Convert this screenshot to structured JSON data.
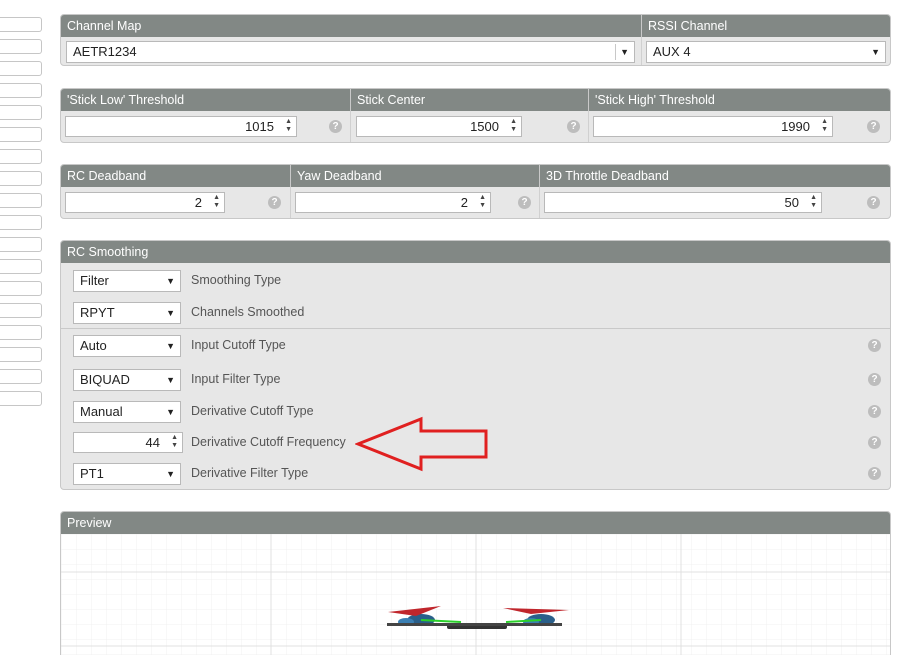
{
  "channel_map": {
    "header": "Channel Map",
    "value": "AETR1234"
  },
  "rssi_channel": {
    "header": "RSSI Channel",
    "value": "AUX 4"
  },
  "thresholds": [
    {
      "header": "'Stick Low' Threshold",
      "value": "1015"
    },
    {
      "header": "Stick Center",
      "value": "1500"
    },
    {
      "header": "'Stick High' Threshold",
      "value": "1990"
    }
  ],
  "deadbands": [
    {
      "header": "RC Deadband",
      "value": "2"
    },
    {
      "header": "Yaw Deadband",
      "value": "2"
    },
    {
      "header": "3D Throttle Deadband",
      "value": "50"
    }
  ],
  "smoothing": {
    "header": "RC Smoothing",
    "rows": [
      {
        "value": "Filter",
        "label": "Smoothing Type"
      },
      {
        "value": "RPYT",
        "label": "Channels Smoothed"
      },
      {
        "value": "Auto",
        "label": "Input Cutoff Type"
      },
      {
        "value": "BIQUAD",
        "label": "Input Filter Type"
      },
      {
        "value": "Manual",
        "label": "Derivative Cutoff Type"
      },
      {
        "value": "44",
        "label": "Derivative Cutoff Frequency"
      },
      {
        "value": "PT1",
        "label": "Derivative Filter Type"
      }
    ]
  },
  "preview": {
    "header": "Preview"
  },
  "icons": {
    "help": "?",
    "dropdown": "▼",
    "spin_up": "▲",
    "spin_down": "▼"
  },
  "colors": {
    "panel_header": "#828885",
    "panel_bg": "#e7e7e7",
    "annotation_arrow": "#e02020"
  }
}
